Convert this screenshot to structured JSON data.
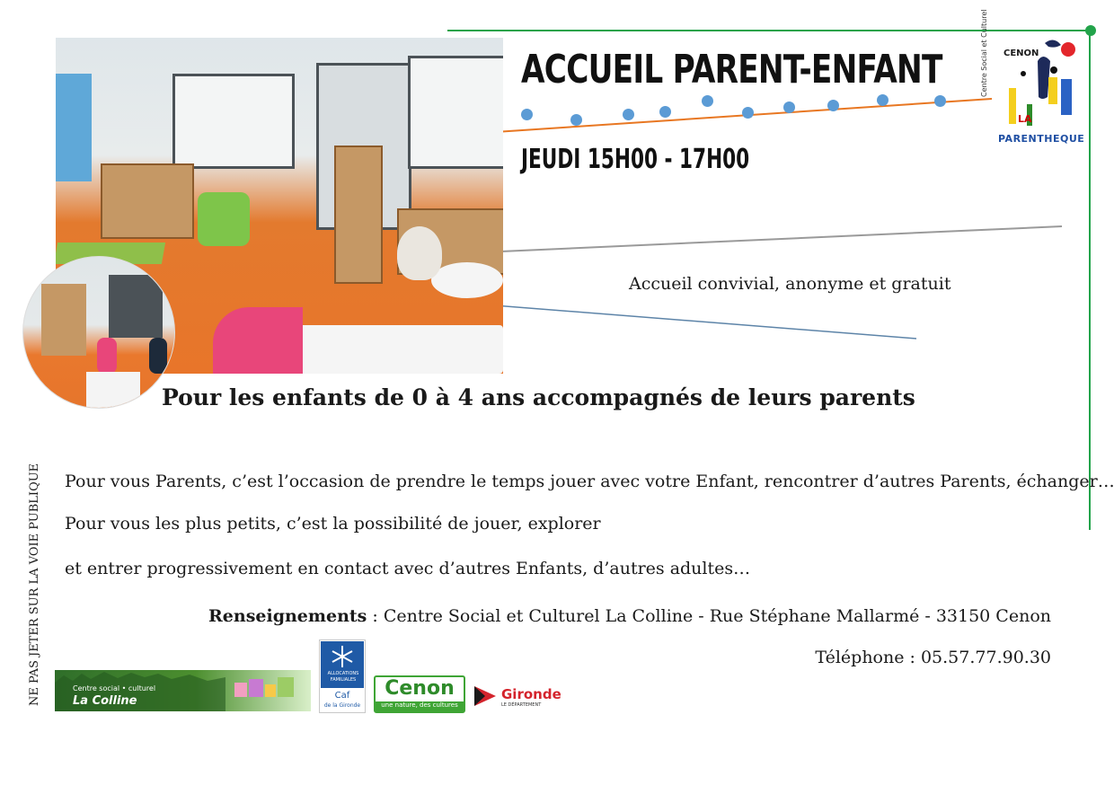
{
  "poster": {
    "title": "ACCUEIL PARENT-ENFANT",
    "schedule": "JEUDI 15H00 - 17H00",
    "tagline": "Accueil convivial, anonyme et gratuit",
    "headline": "Pour les enfants de 0 à 4 ans accompagnés de leurs parents",
    "side_notice": "NE PAS JETER SUR LA VOIE PUBLIQUE",
    "paragraphs": [
      "Pour vous Parents, c’est l’occasion de prendre le temps jouer avec votre Enfant, rencontrer d’autres Parents, échanger…",
      "Pour vous les plus petits, c’est la possibilité de jouer, explorer",
      "et entrer progressivement en contact avec d’autres Enfants, d’autres adultes…"
    ],
    "info_label": "Renseignements",
    "info_text": " :  Centre Social et Culturel  La Colline - Rue Stéphane Mallarmé - 33150 Cenon",
    "phone": "Téléphone : 05.57.77.90.30"
  },
  "logos": {
    "parentheque": {
      "side": "Centre Social et Culturel",
      "cenon": "CENON",
      "la": "LA",
      "name": "PARENTHEQUE"
    },
    "colline": {
      "line1": "Centre social • culturel",
      "line2": "La Colline"
    },
    "caf": {
      "line1": "ALLOCATIONS",
      "line2": "FAMILIALES",
      "caf": "Caf",
      "region": "de la Gironde"
    },
    "cenon": {
      "name": "Cenon",
      "slogan": "une nature, des cultures"
    },
    "gironde": {
      "name": "Gironde",
      "sub": "LE DÉPARTEMENT"
    }
  },
  "colors": {
    "green_frame": "#22a34a",
    "orange_line": "#e87722",
    "blue_dots": "#5b9bd5",
    "gray_line": "#9a9a9a",
    "blue_line": "#5d84a8"
  },
  "icons": [
    "photo-playroom",
    "photo-children-circle",
    "parentheque-logo",
    "colline-logo",
    "caf-logo",
    "cenon-logo",
    "gironde-logo"
  ]
}
